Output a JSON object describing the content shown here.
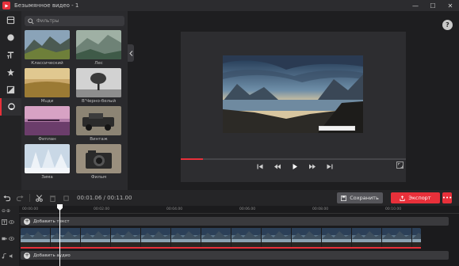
{
  "window": {
    "title": "Безымянное видео - 1",
    "controls": [
      "—",
      "☐",
      "✕"
    ]
  },
  "rail": {
    "items": [
      "media-icon",
      "record-icon",
      "text-icon",
      "effects-icon",
      "transitions-icon",
      "filters-icon"
    ],
    "active": "filters-icon"
  },
  "filters": {
    "search_placeholder": "Фильтры",
    "items": [
      {
        "label": "Классический",
        "icon": "landscape-mountains"
      },
      {
        "label": "Лес",
        "icon": "misty-forest"
      },
      {
        "label": "Мuди",
        "icon": "wheat-field"
      },
      {
        "label": "В'Черно-белый",
        "icon": "lone-tree"
      },
      {
        "label": "Фиплан",
        "icon": "purple-pier"
      },
      {
        "label": "Винтаж",
        "icon": "vintage-car"
      },
      {
        "label": "Зима",
        "icon": "snowy-trees"
      },
      {
        "label": "Фильм",
        "icon": "camera"
      }
    ]
  },
  "preview": {
    "help_label": "?",
    "progress": 0.1
  },
  "toolbar": {
    "timecode": "00:01.06 / 00:11.00",
    "save_label": "Сохранить",
    "export_label": "Экспорт",
    "more_label": "•••"
  },
  "timeline": {
    "zoom_labels": [
      "⊖",
      "⊕"
    ],
    "ruler": [
      "00:00.00",
      "00:02.00",
      "00:04.00",
      "00:06.00",
      "00:08.00",
      "00:10.00"
    ],
    "text_track_label": "Добавить текст",
    "audio_track_label": "Добавить аудио",
    "playhead_time": "00:01.06"
  },
  "colors": {
    "accent": "#e8303a",
    "panel": "#2a2a2d",
    "background": "#1e1e20"
  }
}
